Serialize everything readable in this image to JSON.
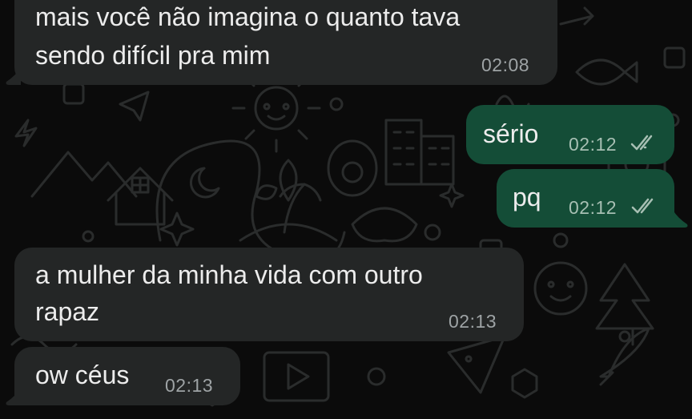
{
  "theme": {
    "background": "#0b0b0b",
    "incoming_bubble": "#242626",
    "outgoing_bubble": "#144d37",
    "text": "#ececec",
    "timestamp": "#9ea3a5"
  },
  "messages": [
    {
      "direction": "incoming",
      "lines": [
        "mais você não imagina o quanto tava",
        "sendo difícil pra mim"
      ],
      "time": "02:08"
    },
    {
      "direction": "outgoing",
      "lines": [
        "sério"
      ],
      "time": "02:12",
      "status_icon": "double-check-icon"
    },
    {
      "direction": "outgoing",
      "lines": [
        "pq"
      ],
      "time": "02:12",
      "status_icon": "double-check-icon"
    },
    {
      "direction": "incoming",
      "lines": [
        "a mulher da minha vida com outro",
        "rapaz"
      ],
      "time": "02:13"
    },
    {
      "direction": "incoming",
      "lines": [
        "ow céus"
      ],
      "time": "02:13"
    }
  ]
}
